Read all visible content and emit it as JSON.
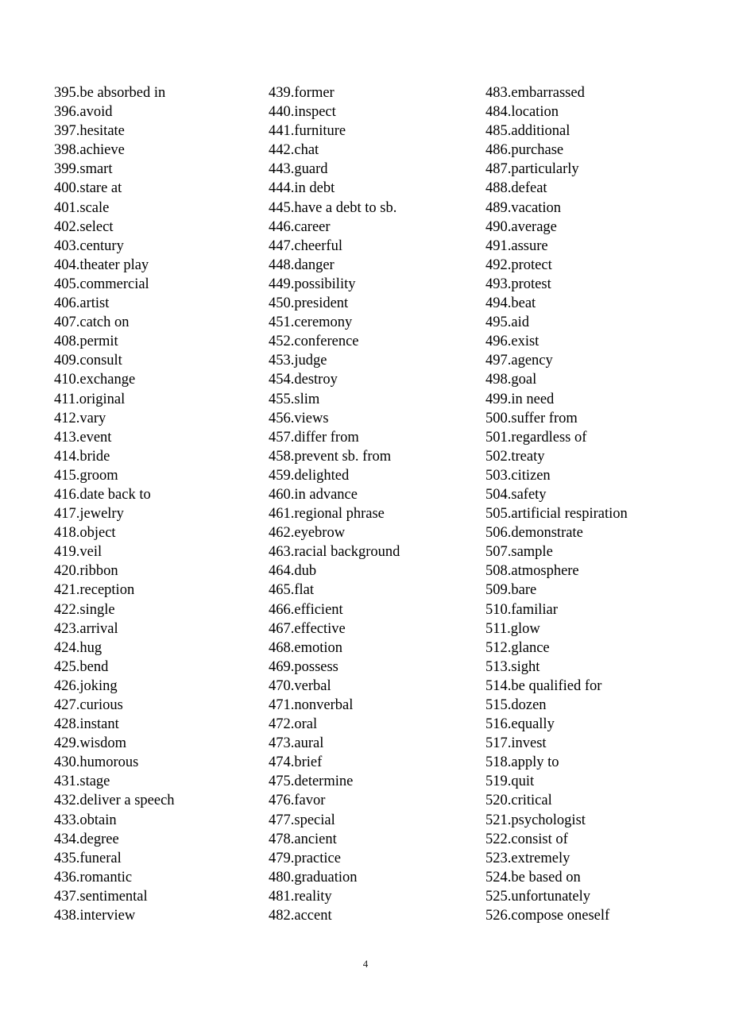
{
  "document": {
    "page_number": "4",
    "columns": [
      {
        "name": "column-1",
        "items": [
          "395.be absorbed in",
          "396.avoid",
          "397.hesitate",
          "398.achieve",
          "399.smart",
          "400.stare at",
          "401.scale",
          "402.select",
          "403.century",
          "404.theater play",
          "405.commercial",
          "406.artist",
          "407.catch on",
          "408.permit",
          "409.consult",
          "410.exchange",
          "411.original",
          "412.vary",
          "413.event",
          "414.bride",
          "415.groom",
          "416.date back to",
          "417.jewelry",
          "418.object",
          "419.veil",
          "420.ribbon",
          "421.reception",
          "422.single",
          "423.arrival",
          "424.hug",
          "425.bend",
          "426.joking",
          "427.curious",
          "428.instant",
          "429.wisdom",
          "430.humorous",
          "431.stage",
          "432.deliver a speech",
          "433.obtain",
          "434.degree",
          "435.funeral",
          "436.romantic",
          "437.sentimental",
          "438.interview"
        ]
      },
      {
        "name": "column-2",
        "items": [
          "439.former",
          "440.inspect",
          "441.furniture",
          "442.chat",
          "443.guard",
          "444.in debt",
          "445.have a debt to sb.",
          "446.career",
          "447.cheerful",
          "448.danger",
          "449.possibility",
          "450.president",
          "451.ceremony",
          "452.conference",
          "453.judge",
          "454.destroy",
          "455.slim",
          "456.views",
          "457.differ from",
          "458.prevent sb. from",
          "459.delighted",
          "460.in advance",
          "461.regional phrase",
          "462.eyebrow",
          "463.racial background",
          "464.dub",
          "465.flat",
          "466.efficient",
          "467.effective",
          "468.emotion",
          "469.possess",
          "470.verbal",
          "471.nonverbal",
          "472.oral",
          "473.aural",
          "474.brief",
          "475.determine",
          "476.favor",
          "477.special",
          "478.ancient",
          "479.practice",
          "480.graduation",
          "481.reality",
          "482.accent"
        ]
      },
      {
        "name": "column-3",
        "items": [
          "483.embarrassed",
          "484.location",
          "485.additional",
          "486.purchase",
          "487.particularly",
          "488.defeat",
          "489.vacation",
          "490.average",
          "491.assure",
          "492.protect",
          "493.protest",
          "494.beat",
          "495.aid",
          "496.exist",
          "497.agency",
          "498.goal",
          "499.in need",
          "500.suffer from",
          "501.regardless of",
          "502.treaty",
          "503.citizen",
          "504.safety",
          "505.artificial respiration",
          "506.demonstrate",
          "507.sample",
          "508.atmosphere",
          "509.bare",
          "510.familiar",
          "511.glow",
          "512.glance",
          "513.sight",
          "514.be qualified for",
          "515.dozen",
          "516.equally",
          "517.invest",
          "518.apply to",
          "519.quit",
          "520.critical",
          "521.psychologist",
          "522.consist of",
          "523.extremely",
          "524.be based on",
          "525.unfortunately",
          "526.compose oneself"
        ]
      }
    ]
  }
}
